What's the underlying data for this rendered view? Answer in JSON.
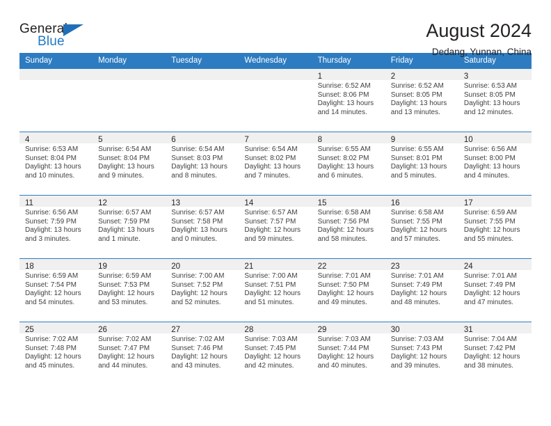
{
  "brand": {
    "name_part1": "General",
    "name_part2": "Blue",
    "logo_icon": "triangle-flag-icon",
    "accent_color": "#1f7ac4"
  },
  "header": {
    "title": "August 2024",
    "location": "Dedang, Yunnan, China",
    "header_bg_color": "#2d7cc1",
    "daynum_band_color": "#f0f0f0"
  },
  "weekday_headers": [
    "Sunday",
    "Monday",
    "Tuesday",
    "Wednesday",
    "Thursday",
    "Friday",
    "Saturday"
  ],
  "labels": {
    "sunrise_prefix": "Sunrise:",
    "sunset_prefix": "Sunset:",
    "daylight_prefix": "Daylight:"
  },
  "weeks": [
    [
      {
        "day": "",
        "sunrise": "",
        "sunset": "",
        "daylight_line1": "",
        "daylight_line2": ""
      },
      {
        "day": "",
        "sunrise": "",
        "sunset": "",
        "daylight_line1": "",
        "daylight_line2": ""
      },
      {
        "day": "",
        "sunrise": "",
        "sunset": "",
        "daylight_line1": "",
        "daylight_line2": ""
      },
      {
        "day": "",
        "sunrise": "",
        "sunset": "",
        "daylight_line1": "",
        "daylight_line2": ""
      },
      {
        "day": "1",
        "sunrise": "Sunrise: 6:52 AM",
        "sunset": "Sunset: 8:06 PM",
        "daylight_line1": "Daylight: 13 hours",
        "daylight_line2": "and 14 minutes."
      },
      {
        "day": "2",
        "sunrise": "Sunrise: 6:52 AM",
        "sunset": "Sunset: 8:05 PM",
        "daylight_line1": "Daylight: 13 hours",
        "daylight_line2": "and 13 minutes."
      },
      {
        "day": "3",
        "sunrise": "Sunrise: 6:53 AM",
        "sunset": "Sunset: 8:05 PM",
        "daylight_line1": "Daylight: 13 hours",
        "daylight_line2": "and 12 minutes."
      }
    ],
    [
      {
        "day": "4",
        "sunrise": "Sunrise: 6:53 AM",
        "sunset": "Sunset: 8:04 PM",
        "daylight_line1": "Daylight: 13 hours",
        "daylight_line2": "and 10 minutes."
      },
      {
        "day": "5",
        "sunrise": "Sunrise: 6:54 AM",
        "sunset": "Sunset: 8:04 PM",
        "daylight_line1": "Daylight: 13 hours",
        "daylight_line2": "and 9 minutes."
      },
      {
        "day": "6",
        "sunrise": "Sunrise: 6:54 AM",
        "sunset": "Sunset: 8:03 PM",
        "daylight_line1": "Daylight: 13 hours",
        "daylight_line2": "and 8 minutes."
      },
      {
        "day": "7",
        "sunrise": "Sunrise: 6:54 AM",
        "sunset": "Sunset: 8:02 PM",
        "daylight_line1": "Daylight: 13 hours",
        "daylight_line2": "and 7 minutes."
      },
      {
        "day": "8",
        "sunrise": "Sunrise: 6:55 AM",
        "sunset": "Sunset: 8:02 PM",
        "daylight_line1": "Daylight: 13 hours",
        "daylight_line2": "and 6 minutes."
      },
      {
        "day": "9",
        "sunrise": "Sunrise: 6:55 AM",
        "sunset": "Sunset: 8:01 PM",
        "daylight_line1": "Daylight: 13 hours",
        "daylight_line2": "and 5 minutes."
      },
      {
        "day": "10",
        "sunrise": "Sunrise: 6:56 AM",
        "sunset": "Sunset: 8:00 PM",
        "daylight_line1": "Daylight: 13 hours",
        "daylight_line2": "and 4 minutes."
      }
    ],
    [
      {
        "day": "11",
        "sunrise": "Sunrise: 6:56 AM",
        "sunset": "Sunset: 7:59 PM",
        "daylight_line1": "Daylight: 13 hours",
        "daylight_line2": "and 3 minutes."
      },
      {
        "day": "12",
        "sunrise": "Sunrise: 6:57 AM",
        "sunset": "Sunset: 7:59 PM",
        "daylight_line1": "Daylight: 13 hours",
        "daylight_line2": "and 1 minute."
      },
      {
        "day": "13",
        "sunrise": "Sunrise: 6:57 AM",
        "sunset": "Sunset: 7:58 PM",
        "daylight_line1": "Daylight: 13 hours",
        "daylight_line2": "and 0 minutes."
      },
      {
        "day": "14",
        "sunrise": "Sunrise: 6:57 AM",
        "sunset": "Sunset: 7:57 PM",
        "daylight_line1": "Daylight: 12 hours",
        "daylight_line2": "and 59 minutes."
      },
      {
        "day": "15",
        "sunrise": "Sunrise: 6:58 AM",
        "sunset": "Sunset: 7:56 PM",
        "daylight_line1": "Daylight: 12 hours",
        "daylight_line2": "and 58 minutes."
      },
      {
        "day": "16",
        "sunrise": "Sunrise: 6:58 AM",
        "sunset": "Sunset: 7:55 PM",
        "daylight_line1": "Daylight: 12 hours",
        "daylight_line2": "and 57 minutes."
      },
      {
        "day": "17",
        "sunrise": "Sunrise: 6:59 AM",
        "sunset": "Sunset: 7:55 PM",
        "daylight_line1": "Daylight: 12 hours",
        "daylight_line2": "and 55 minutes."
      }
    ],
    [
      {
        "day": "18",
        "sunrise": "Sunrise: 6:59 AM",
        "sunset": "Sunset: 7:54 PM",
        "daylight_line1": "Daylight: 12 hours",
        "daylight_line2": "and 54 minutes."
      },
      {
        "day": "19",
        "sunrise": "Sunrise: 6:59 AM",
        "sunset": "Sunset: 7:53 PM",
        "daylight_line1": "Daylight: 12 hours",
        "daylight_line2": "and 53 minutes."
      },
      {
        "day": "20",
        "sunrise": "Sunrise: 7:00 AM",
        "sunset": "Sunset: 7:52 PM",
        "daylight_line1": "Daylight: 12 hours",
        "daylight_line2": "and 52 minutes."
      },
      {
        "day": "21",
        "sunrise": "Sunrise: 7:00 AM",
        "sunset": "Sunset: 7:51 PM",
        "daylight_line1": "Daylight: 12 hours",
        "daylight_line2": "and 51 minutes."
      },
      {
        "day": "22",
        "sunrise": "Sunrise: 7:01 AM",
        "sunset": "Sunset: 7:50 PM",
        "daylight_line1": "Daylight: 12 hours",
        "daylight_line2": "and 49 minutes."
      },
      {
        "day": "23",
        "sunrise": "Sunrise: 7:01 AM",
        "sunset": "Sunset: 7:49 PM",
        "daylight_line1": "Daylight: 12 hours",
        "daylight_line2": "and 48 minutes."
      },
      {
        "day": "24",
        "sunrise": "Sunrise: 7:01 AM",
        "sunset": "Sunset: 7:49 PM",
        "daylight_line1": "Daylight: 12 hours",
        "daylight_line2": "and 47 minutes."
      }
    ],
    [
      {
        "day": "25",
        "sunrise": "Sunrise: 7:02 AM",
        "sunset": "Sunset: 7:48 PM",
        "daylight_line1": "Daylight: 12 hours",
        "daylight_line2": "and 45 minutes."
      },
      {
        "day": "26",
        "sunrise": "Sunrise: 7:02 AM",
        "sunset": "Sunset: 7:47 PM",
        "daylight_line1": "Daylight: 12 hours",
        "daylight_line2": "and 44 minutes."
      },
      {
        "day": "27",
        "sunrise": "Sunrise: 7:02 AM",
        "sunset": "Sunset: 7:46 PM",
        "daylight_line1": "Daylight: 12 hours",
        "daylight_line2": "and 43 minutes."
      },
      {
        "day": "28",
        "sunrise": "Sunrise: 7:03 AM",
        "sunset": "Sunset: 7:45 PM",
        "daylight_line1": "Daylight: 12 hours",
        "daylight_line2": "and 42 minutes."
      },
      {
        "day": "29",
        "sunrise": "Sunrise: 7:03 AM",
        "sunset": "Sunset: 7:44 PM",
        "daylight_line1": "Daylight: 12 hours",
        "daylight_line2": "and 40 minutes."
      },
      {
        "day": "30",
        "sunrise": "Sunrise: 7:03 AM",
        "sunset": "Sunset: 7:43 PM",
        "daylight_line1": "Daylight: 12 hours",
        "daylight_line2": "and 39 minutes."
      },
      {
        "day": "31",
        "sunrise": "Sunrise: 7:04 AM",
        "sunset": "Sunset: 7:42 PM",
        "daylight_line1": "Daylight: 12 hours",
        "daylight_line2": "and 38 minutes."
      }
    ]
  ]
}
